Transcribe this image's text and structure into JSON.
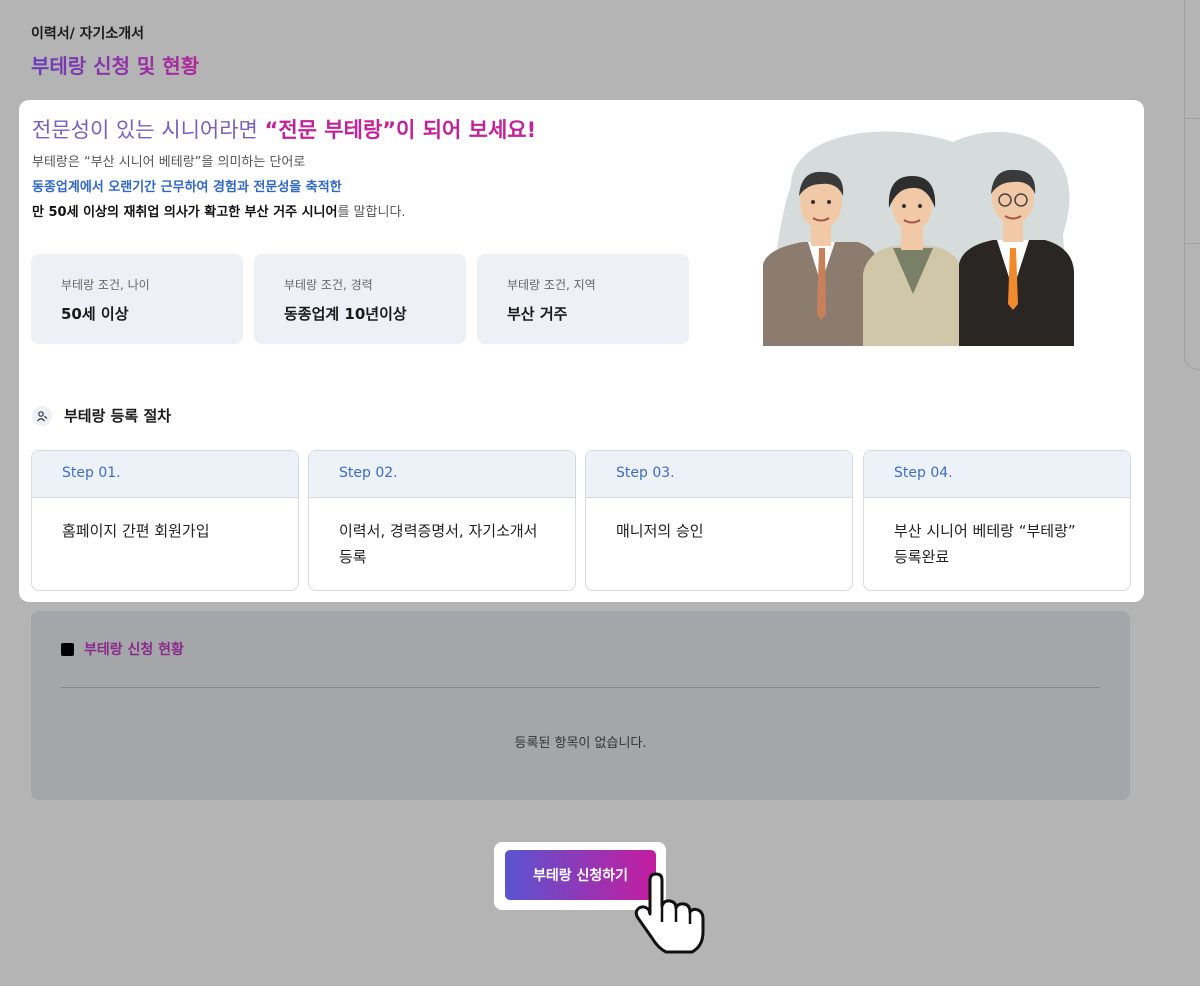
{
  "header": {
    "breadcrumb": "이력서/ 자기소개서",
    "title": "부테랑 신청 및 현황"
  },
  "intro": {
    "headline_plain": "전문성이 있는 시니어라면 ",
    "headline_highlight": "“전문 부테랑”이 되어 보세요!",
    "line1": "부테랑은 “부산 시니어 베테랑”을 의미하는 단어로",
    "line2": "동종업계에서 오랜기간 근무하여 경험과 전문성을 축적한",
    "line3_bold": "만 50세 이상의 재취업 의사가 확고한 부산 거주 시니어",
    "line3_rest": "를 말합니다."
  },
  "conditions": [
    {
      "label": "부테랑 조건, 나이",
      "value": "50세 이상"
    },
    {
      "label": "부테랑 조건, 경력",
      "value": "동종업계 10년이상"
    },
    {
      "label": "부테랑 조건, 지역",
      "value": "부산 거주"
    }
  ],
  "process": {
    "title": "부테랑 등록 절차",
    "steps": [
      {
        "step": "Step 01.",
        "text": "홈페이지 간편 회원가입"
      },
      {
        "step": "Step 02.",
        "text": "이력서, 경력증명서, 자기소개서\n등록"
      },
      {
        "step": "Step 03.",
        "text": "매니저의 승인"
      },
      {
        "step": "Step 04.",
        "text": "부산 시니어 베테랑 “부테랑”\n등록완료"
      }
    ]
  },
  "status": {
    "title": "부테랑 신청 현황",
    "empty_message": "등록된 항목이 없습니다."
  },
  "apply_button": "부테랑 신청하기",
  "colors": {
    "accent_purple": "#7760c0",
    "accent_magenta": "#c2229a",
    "link_blue": "#2f68c8",
    "background": "#b4b4b4"
  }
}
